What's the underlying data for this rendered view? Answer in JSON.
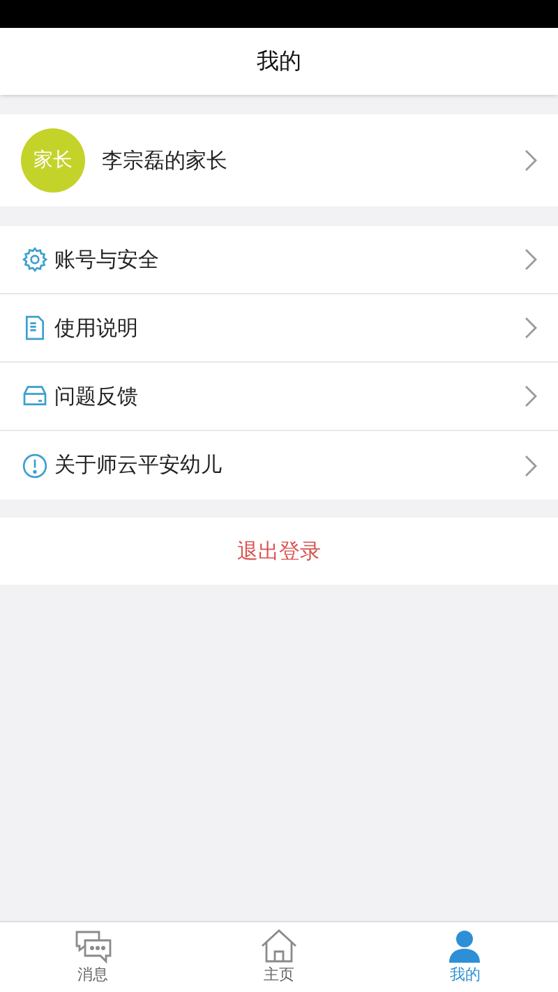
{
  "header": {
    "title": "我的"
  },
  "profile": {
    "avatar": "家长",
    "name": "李宗磊的家长"
  },
  "menu": [
    {
      "kind": "settings",
      "label": "账号与安全"
    },
    {
      "kind": "document",
      "label": "使用说明"
    },
    {
      "kind": "tray",
      "label": "问题反馈"
    },
    {
      "kind": "info",
      "label": "关于师云平安幼儿"
    }
  ],
  "logout": "退出登录",
  "tabs": [
    {
      "kind": "message",
      "label": "消息",
      "selected": false
    },
    {
      "kind": "home",
      "label": "主页",
      "selected": false
    },
    {
      "kind": "person",
      "label": "我的",
      "selected": true
    }
  ]
}
